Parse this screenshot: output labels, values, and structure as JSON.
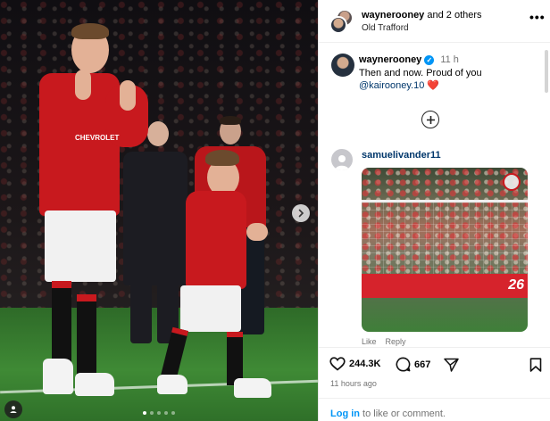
{
  "post": {
    "photo_alt": "Wayne Rooney and son on the Old Trafford pitch",
    "carousel": {
      "total": 5,
      "active": 0
    }
  },
  "header": {
    "author": "waynerooney",
    "coauthors": "and 2 others",
    "location": "Old Trafford",
    "more_label": "•••"
  },
  "caption": {
    "username": "waynerooney",
    "time": "11 h",
    "text": "Then and now. Proud of you",
    "mention": "@kairooney.10",
    "emoji": "❤️"
  },
  "comment": {
    "username": "samuelivander11",
    "media_board_text": "26",
    "like_label": "Like",
    "reply_label": "Reply"
  },
  "actions": {
    "likes": "244.3K",
    "comments": "667",
    "time_ago": "11 hours ago"
  },
  "login": {
    "link": "Log in",
    "text": " to like or comment."
  },
  "colors": {
    "accent": "#0095f6",
    "mention": "#00376b",
    "united_red": "#c8191e"
  }
}
